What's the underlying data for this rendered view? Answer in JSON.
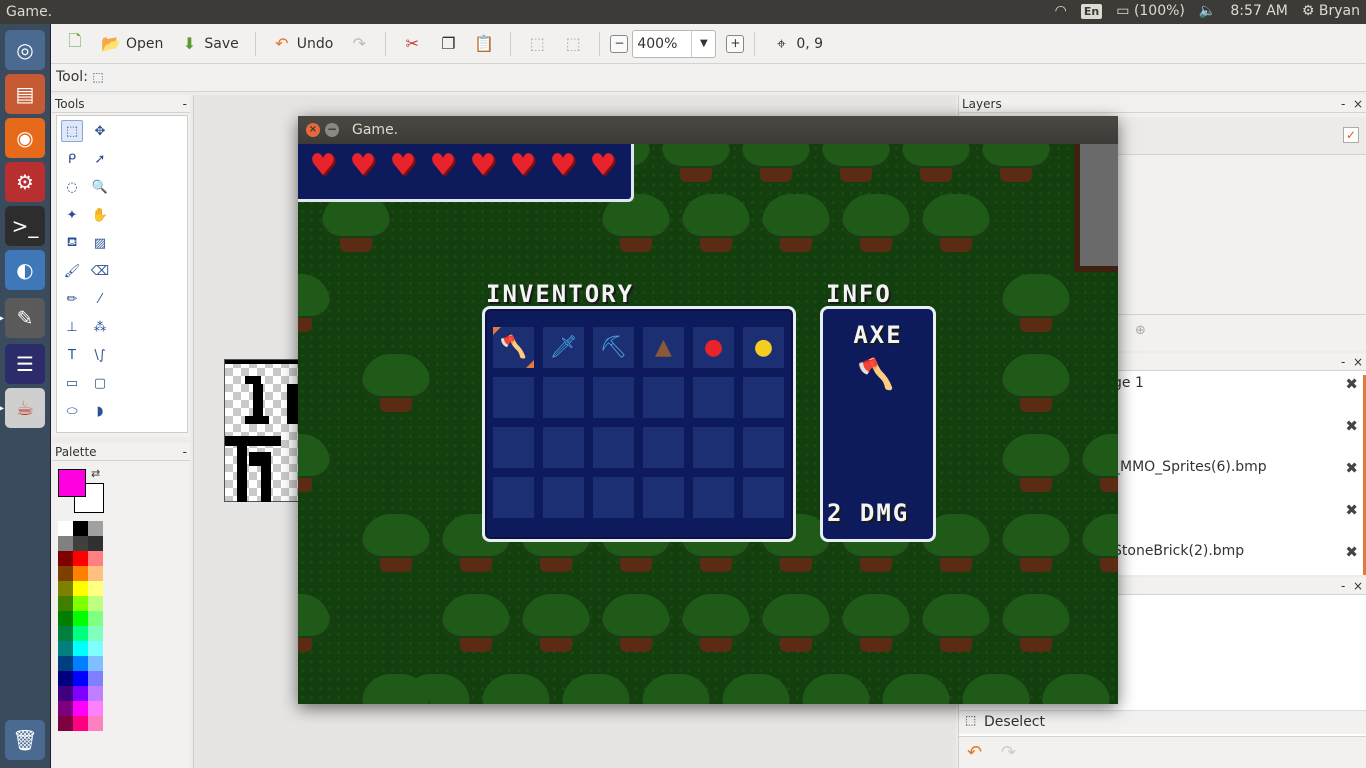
{
  "system": {
    "window_title": "Game.",
    "keyboard": "En",
    "battery": "(100%)",
    "time": "8:57 AM",
    "user": "Bryan"
  },
  "launcher": {
    "items": [
      "ubuntu-logo-icon",
      "files-icon",
      "firefox-icon",
      "settings-icon",
      "terminal-icon",
      "remmina-icon",
      "pinta-icon",
      "eclipse-icon",
      "java-icon",
      "trash-icon"
    ]
  },
  "toolbar": {
    "new_label": "",
    "open_label": "Open",
    "save_label": "Save",
    "undo_label": "Undo",
    "zoom_value": "400%",
    "cursor_position": "0, 9"
  },
  "toolrow": {
    "label": "Tool:"
  },
  "tools_panel": {
    "title": "Tools",
    "collapse": "-"
  },
  "palette_panel": {
    "title": "Palette",
    "collapse": "-",
    "primary_color": "#ff00e0",
    "secondary_color": "#ffffff",
    "colors": [
      "#ffffff",
      "#000000",
      "#a0a0a0",
      "#808080",
      "#404040",
      "#303030",
      "#7f0000",
      "#ff0000",
      "#ff8080",
      "#7f3f00",
      "#ff7f00",
      "#ffbf80",
      "#7f7f00",
      "#ffff00",
      "#ffff80",
      "#3f7f00",
      "#80ff00",
      "#bfff80",
      "#007f00",
      "#00ff00",
      "#80ff80",
      "#007f3f",
      "#00ff80",
      "#80ffbf",
      "#007f7f",
      "#00ffff",
      "#80ffff",
      "#003f7f",
      "#0080ff",
      "#80bfff",
      "#00007f",
      "#0000ff",
      "#8080ff",
      "#3f007f",
      "#8000ff",
      "#bf80ff",
      "#7f007f",
      "#ff00ff",
      "#ff80ff",
      "#7f003f",
      "#ff0080",
      "#ff80bf"
    ]
  },
  "layers_panel": {
    "title": "Layers",
    "collapse": "-",
    "close": "×"
  },
  "images_panel": {
    "collapse": "-",
    "close": "×",
    "items": [
      "ge 1",
      "",
      "_MMO_Sprites(6).bmp",
      "",
      "StoneBrick(2).bmp"
    ]
  },
  "history_panel": {
    "collapse": "-",
    "close": "×",
    "item": "Deselect"
  },
  "game_window": {
    "title": "Game.",
    "hearts": 8,
    "inventory_title": "INVENTORY",
    "info_title": "INFO",
    "selected_item_name": "AXE",
    "selected_item_damage": "2 DMG",
    "items": [
      {
        "name": "axe-icon",
        "glyph": "🪓",
        "color": "#4aa6e6"
      },
      {
        "name": "sword-icon",
        "glyph": "🗡",
        "color": "#4aa6e6"
      },
      {
        "name": "pickaxe-icon",
        "glyph": "⛏",
        "color": "#4aa6e6"
      },
      {
        "name": "ore-pile-icon",
        "glyph": "▲",
        "color": "#8a5a36"
      },
      {
        "name": "apple-icon",
        "glyph": "●",
        "color": "#e8232b"
      },
      {
        "name": "coin-icon",
        "glyph": "●",
        "color": "#f4cc22"
      }
    ],
    "slot_columns": 6,
    "slot_rows": 4
  }
}
